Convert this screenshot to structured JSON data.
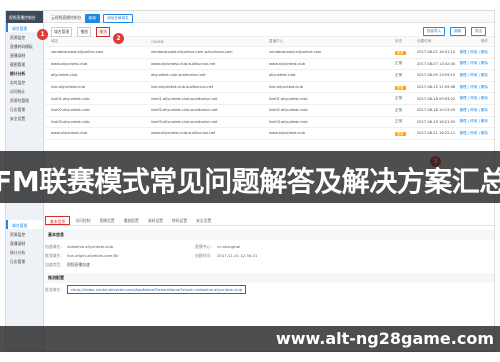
{
  "sidebar": {
    "header": "视频直播控制台",
    "items": [
      {
        "label": "域名管理",
        "active": true
      },
      {
        "label": "资源监控",
        "active": false
      },
      {
        "label": "直播转码模板",
        "active": false
      },
      {
        "label": "直播录制",
        "active": false
      },
      {
        "label": "截图管理",
        "active": false
      },
      {
        "label": "统计分析",
        "active": false
      },
      {
        "label": "实时监控",
        "active": false
      },
      {
        "label": "访问统计",
        "active": false
      },
      {
        "label": "资源包管理",
        "active": false
      },
      {
        "label": "日志管理",
        "active": false
      },
      {
        "label": "安全设置",
        "active": false
      }
    ],
    "lower_items": [
      {
        "label": "域名管理"
      },
      {
        "label": "资源监控"
      },
      {
        "label": "直播录制"
      },
      {
        "label": "统计分析"
      },
      {
        "label": "日志管理"
      }
    ]
  },
  "topbar": {
    "label": "云视频直播控制台",
    "btn_primary": "新增",
    "btn_secondary": "添加全局域名"
  },
  "toolbar": {
    "tab_all": "域名管理",
    "tab_mid": "播放",
    "tab_sel": "推流",
    "btn_import": "批量导入",
    "btn_refresh": "刷新",
    "btn_export": "导出"
  },
  "badges": {
    "one": "1",
    "two": "2",
    "three": "3"
  },
  "table": {
    "headers": [
      "域名",
      "CNAME",
      "直播中心",
      "状态",
      "创建时间",
      "操作"
    ],
    "rows": [
      [
        "vendacanoast.aliyunlive.com",
        "vendacanoast.aliyunlive.com.w.kunlunar.com",
        "vendacanoast.aliyunlive.com",
        "配置",
        "2017-08-01 16:41:10",
        "管理 | 停用 | 删除"
      ],
      [
        "www.aliyuntest.club",
        "www.aliyuntest.club.w.alikunlun.net",
        "www.aliyuntest.club",
        "正常",
        "2017-08-07 13:42:40",
        "管理 | 停用 | 删除"
      ],
      [
        "aliyuntest.club",
        "aliyuntest.club.w.alikunlun.net",
        "aliyuntest.club",
        "正常",
        "2017-08-09 13:59:10",
        "管理 | 停用 | 删除"
      ],
      [
        "live.aliyuntest.club",
        "live.aliyuntest.club.w.alikunlun.net",
        "live.aliyuntest.club",
        "配置",
        "2017-08-15 11:09:48",
        "管理 | 停用 | 删除"
      ],
      [
        "live01.aliyuntest.club",
        "live01.aliyuntest.club.w.alikunlun.net",
        "live01.aliyuntest.club",
        "正常",
        "2017-08-16 09:03:22",
        "管理 | 停用 | 删除"
      ],
      [
        "live02.aliyuntest.club",
        "live02.aliyuntest.club.w.alikunlun.net",
        "live02.aliyuntest.club",
        "正常",
        "2017-08-18 10:15:03",
        "管理 | 停用 | 删除"
      ],
      [
        "live03.aliyuntest.club",
        "live03.aliyuntest.club.w.alikunlun.net",
        "live03.aliyuntest.club",
        "正常",
        "2017-08-19 16:21:55",
        "管理 | 停用 | 删除"
      ],
      [
        "www.aliyuntest.club",
        "www.aliyuntest.club.w.alikunlun.net",
        "www.aliyuntest.club",
        "配置",
        "2017-08-21 16:22:11",
        "管理 | 停用 | 删除"
      ]
    ]
  },
  "banner": {
    "text": "FM联赛模式常见问题解答及解决方案汇总"
  },
  "detail": {
    "tabs": [
      "基本信息",
      "访问控制",
      "直播设置",
      "播放配置",
      "录制设置",
      "转码设置",
      "安全设置"
    ],
    "section_basic": "基本信息",
    "domain_label": "加速域名：",
    "domain_value": "videolive.aliyuntest.club",
    "region_label": "直播中心：",
    "region_value": "cn-shanghai",
    "cname_label": "推流域名：",
    "cname_value": "live-origin.alivecdn.com:80",
    "created_label": "创建时间：",
    "created_value": "2017-11-01 12:30:21",
    "type_label": "加速类型：",
    "type_value": "视频直播加速",
    "section_push": "推流配置",
    "push_label": "推流域名：",
    "push_value": "rtmp://video-center.alivecdn.com/AppName/StreamName?vhost=videolive.aliyuntest.club"
  },
  "footer": {
    "text": "www.alt-ng28game.com"
  }
}
